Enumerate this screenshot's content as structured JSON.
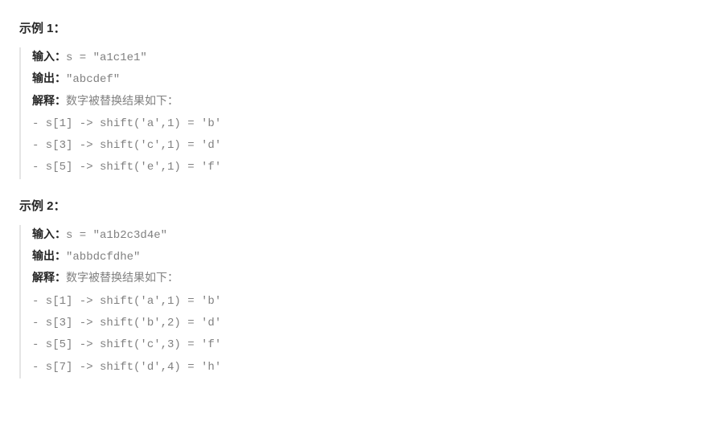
{
  "examples": [
    {
      "heading": "示例 1：",
      "input_label": "输入：",
      "input_value": "s = \"a1c1e1\"",
      "output_label": "输出：",
      "output_value": "\"abcdef\"",
      "explain_label": "解释：",
      "explain_value": "数字被替换结果如下：",
      "lines": [
        "- s[1] -> shift('a',1) = 'b'",
        "- s[3] -> shift('c',1) = 'd'",
        "- s[5] -> shift('e',1) = 'f'"
      ]
    },
    {
      "heading": "示例 2：",
      "input_label": "输入：",
      "input_value": "s = \"a1b2c3d4e\"",
      "output_label": "输出：",
      "output_value": "\"abbdcfdhe\"",
      "explain_label": "解释：",
      "explain_value": "数字被替换结果如下：",
      "lines": [
        "- s[1] -> shift('a',1) = 'b'",
        "- s[3] -> shift('b',2) = 'd'",
        "- s[5] -> shift('c',3) = 'f'",
        "- s[7] -> shift('d',4) = 'h'"
      ]
    }
  ]
}
